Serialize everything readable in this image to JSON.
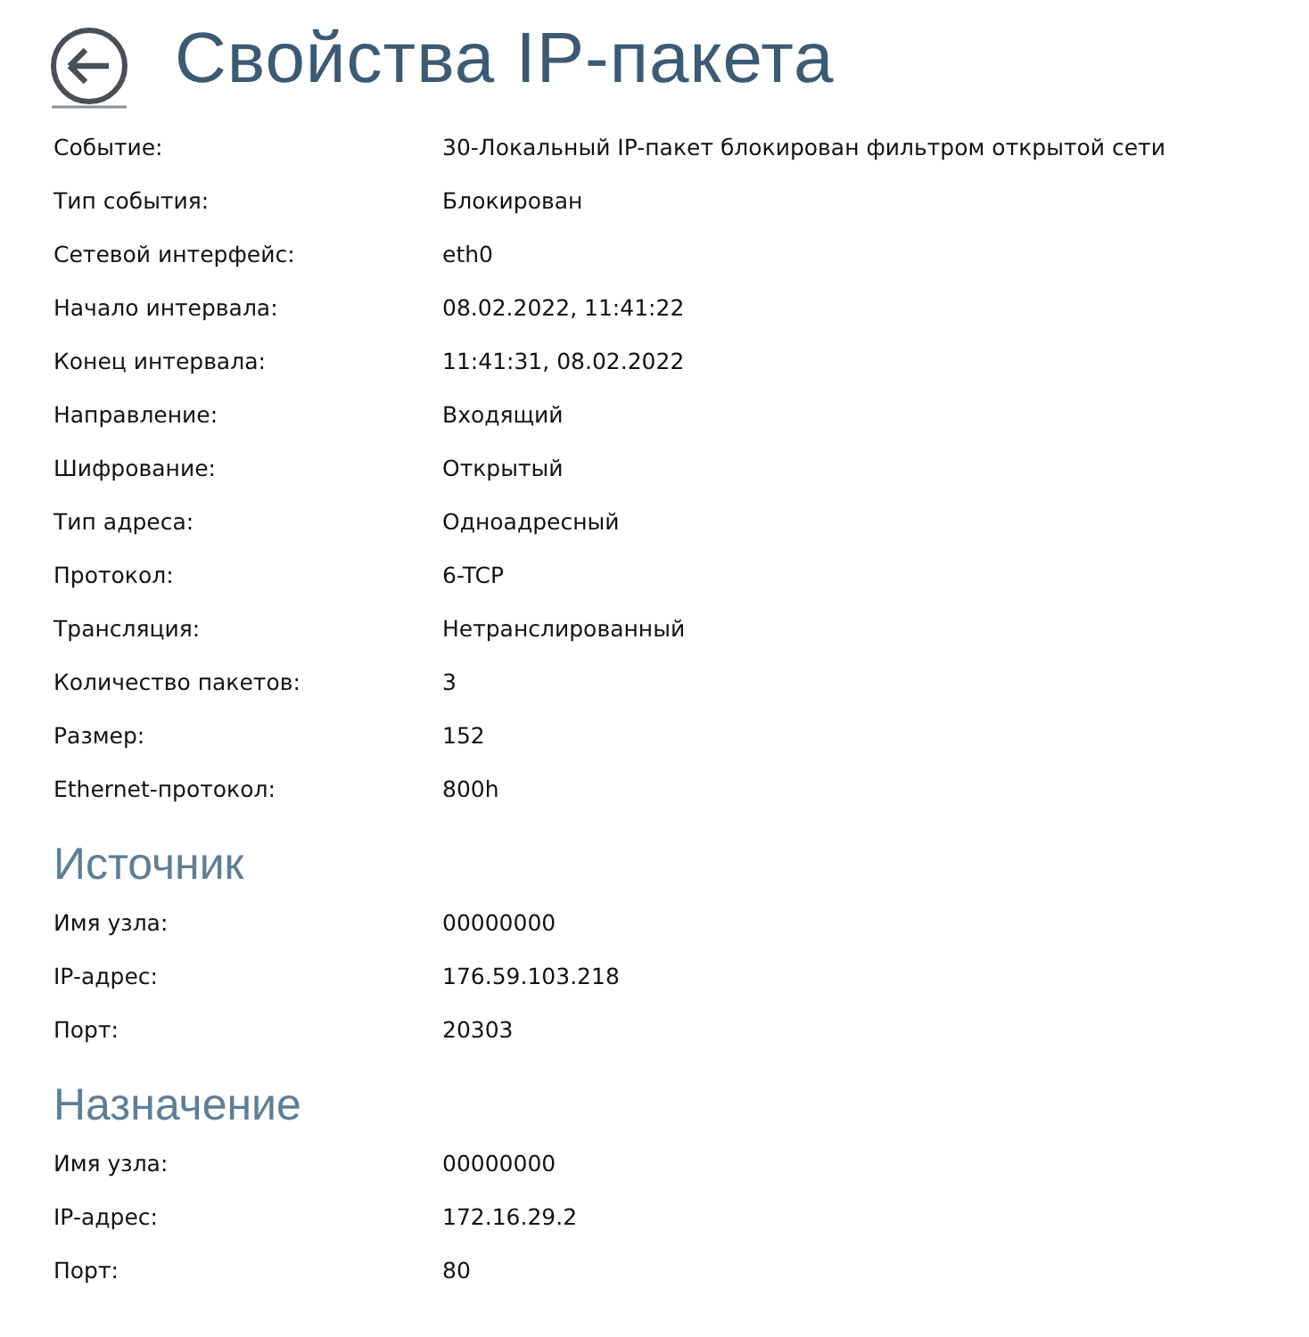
{
  "title": "Свойства IP-пакета",
  "fields": [
    {
      "label": "Событие:",
      "value": "30-Локальный IP-пакет блокирован фильтром открытой сети"
    },
    {
      "label": "Тип события:",
      "value": "Блокирован"
    },
    {
      "label": "Сетевой интерфейс:",
      "value": "eth0"
    },
    {
      "label": "Начало интервала:",
      "value": "08.02.2022, 11:41:22"
    },
    {
      "label": "Конец интервала:",
      "value": "11:41:31, 08.02.2022"
    },
    {
      "label": "Направление:",
      "value": "Входящий"
    },
    {
      "label": "Шифрование:",
      "value": "Открытый"
    },
    {
      "label": "Тип адреса:",
      "value": "Одноадресный"
    },
    {
      "label": "Протокол:",
      "value": "6-TCP"
    },
    {
      "label": "Трансляция:",
      "value": "Нетранслированный"
    },
    {
      "label": "Количество пакетов:",
      "value": "3"
    },
    {
      "label": "Размер:",
      "value": "152"
    },
    {
      "label": "Ethernet-протокол:",
      "value": "800h"
    }
  ],
  "sections": [
    {
      "heading": "Источник",
      "fields": [
        {
          "label": "Имя узла:",
          "value": "00000000"
        },
        {
          "label": "IP-адрес:",
          "value": "176.59.103.218"
        },
        {
          "label": "Порт:",
          "value": "20303"
        }
      ]
    },
    {
      "heading": "Назначение",
      "fields": [
        {
          "label": "Имя узла:",
          "value": "00000000"
        },
        {
          "label": "IP-адрес:",
          "value": "172.16.29.2"
        },
        {
          "label": "Порт:",
          "value": "80"
        }
      ]
    }
  ]
}
